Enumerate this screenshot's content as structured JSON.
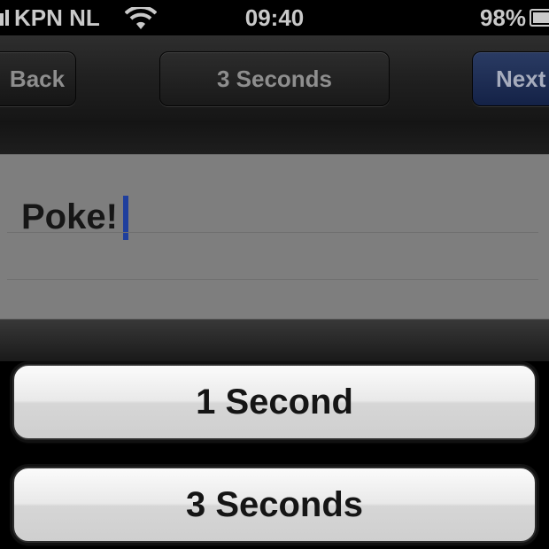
{
  "status_bar": {
    "carrier": "KPN NL",
    "time": "09:40",
    "battery_percent": "98%",
    "icons": [
      "signal-bars-icon",
      "wifi-icon",
      "battery-icon"
    ]
  },
  "nav_bar": {
    "back_label": "Back",
    "title_label": "3 Seconds",
    "next_label": "Next"
  },
  "note": {
    "text": "Poke!"
  },
  "action_sheet": {
    "options": [
      "1 Second",
      "3 Seconds"
    ]
  },
  "colors": {
    "next_button": "#142247",
    "caret": "#1f3f9d",
    "note_background": "#7e7e7e"
  }
}
